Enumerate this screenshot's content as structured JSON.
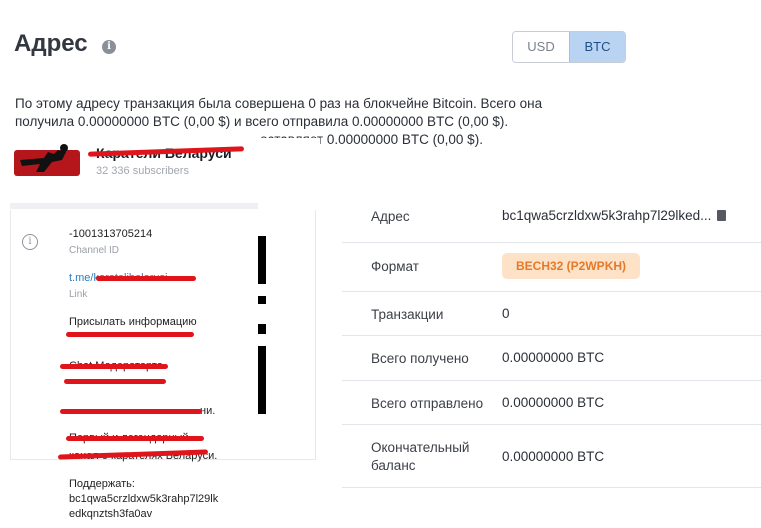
{
  "header": {
    "title": "Адрес",
    "info_icon": "info-icon"
  },
  "currency_toggle": {
    "options": [
      "USD",
      "BTC"
    ],
    "selected": "BTC"
  },
  "summary": {
    "line1": "По этому адресу транзакция была совершена 0 раз на блокчейне Bitcoin. Всего она",
    "line2": "получила 0.00000000 BTC (0,00 $) и всего отправила 0.00000000 BTC (0,00 $).",
    "line3": "оставляет 0.00000000 BTC (0,00 $)."
  },
  "telegram_overlay": {
    "channel_name": "Каратели Беларуси",
    "subscribers": "32 336 subscribers",
    "channel_id": "-1001313705214",
    "channel_id_label": "Channel ID",
    "link": "t.me/karatelibelarusi",
    "link_label": "Link",
    "send_info": "Присылать информацию",
    "line_a": "Chat Модераторта",
    "line_c": "ни.",
    "line_d": "Первый и легендарный",
    "line_e": "канал о карателях Беларуси.",
    "support_label": "Поддержать:",
    "support_address_1": "bc1qwa5crzldxw5k3rahp7l29lk",
    "support_address_2": "edkqnztsh3fa0av"
  },
  "details": {
    "rows": [
      {
        "label": "Адрес",
        "value": "bc1qwa5crzldxw5k3rahp7l29lked..."
      },
      {
        "label": "Формат",
        "value": "BECH32 (P2WPKH)"
      },
      {
        "label": "Транзакции",
        "value": "0"
      },
      {
        "label": "Всего получено",
        "value": "0.00000000 BTC"
      },
      {
        "label": "Всего отправлено",
        "value": "0.00000000 BTC"
      },
      {
        "label": "Окончательный баланс",
        "value": "0.00000000 BTC",
        "label_line1": "Окончательный",
        "label_line2": "баланс"
      }
    ]
  },
  "colors": {
    "badge_bg": "#fde2c8",
    "badge_text": "#e47a2a",
    "toggle_active": "#b9d4f3",
    "redaction": "#e0141b"
  }
}
